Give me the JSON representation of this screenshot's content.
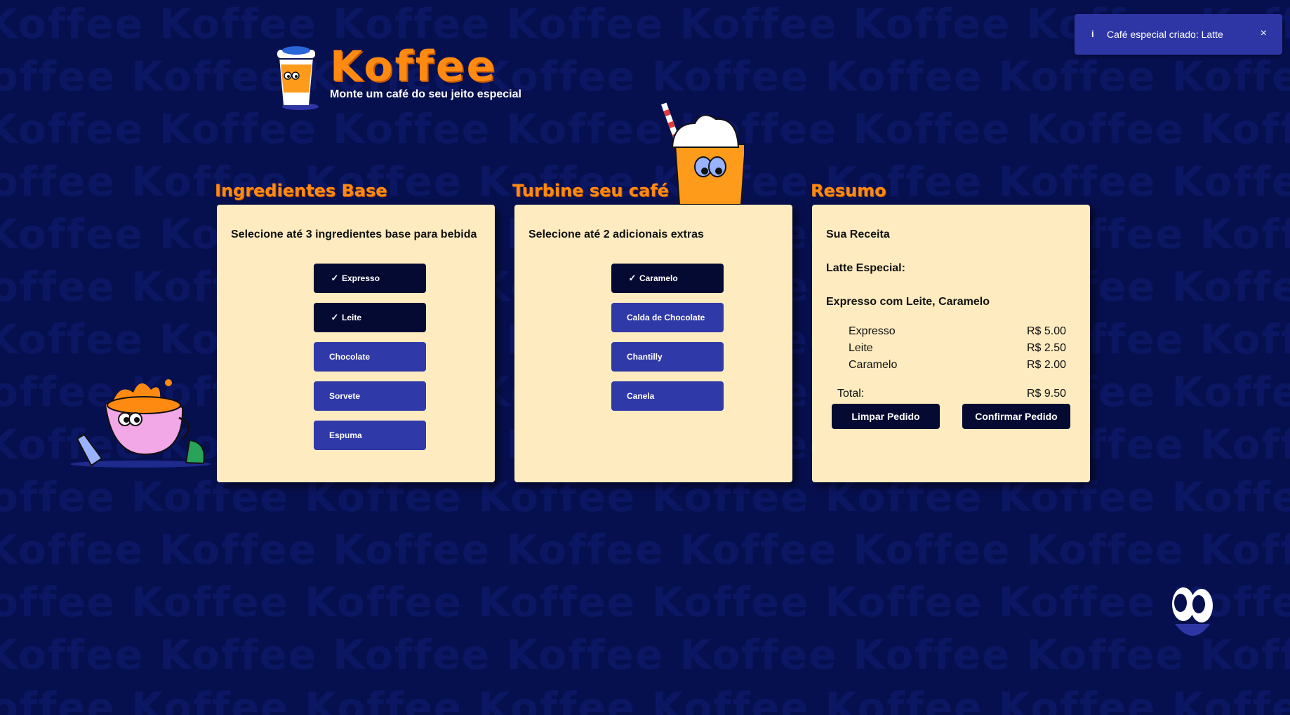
{
  "colors": {
    "background": "#07104f",
    "brand_orange": "#ff8a12",
    "card": "#feebbf",
    "button_blue": "#3039a8",
    "button_selected": "#050a33",
    "toast": "#2e36a6"
  },
  "background_watermark": "Koffee",
  "brand": {
    "logo_icon": "coffee-cup-mascot-icon",
    "title": "Koffee",
    "subtitle": "Monte um café do seu jeito especial"
  },
  "toast": {
    "icon": "info-icon",
    "icon_glyph": "i",
    "message": "Café especial criado: Latte",
    "close": "×"
  },
  "base": {
    "title": "Ingredientes Base",
    "instruction": "Selecione até 3 ingredientes base para bebida",
    "options": [
      {
        "label": "Expresso",
        "selected": true
      },
      {
        "label": "Leite",
        "selected": true
      },
      {
        "label": "Chocolate",
        "selected": false
      },
      {
        "label": "Sorvete",
        "selected": false
      },
      {
        "label": "Espuma",
        "selected": false
      }
    ]
  },
  "extras": {
    "title": "Turbine seu café",
    "instruction": "Selecione até 2 adicionais extras",
    "options": [
      {
        "label": "Caramelo",
        "selected": true
      },
      {
        "label": "Calda de Chocolate",
        "selected": false
      },
      {
        "label": "Chantilly",
        "selected": false
      },
      {
        "label": "Canela",
        "selected": false
      }
    ]
  },
  "check_glyph": "✓",
  "summary": {
    "title": "Resumo",
    "recipe_label": "Sua Receita",
    "drink_name": "Latte Especial:",
    "description": "Expresso com Leite, Caramelo",
    "items": [
      {
        "name": "Expresso",
        "price": "R$ 5.00"
      },
      {
        "name": "Leite",
        "price": "R$ 2.50"
      },
      {
        "name": "Caramelo",
        "price": "R$ 2.00"
      }
    ],
    "total_label": "Total:",
    "total_value": "R$ 9.50",
    "clear_label": "Limpar Pedido",
    "confirm_label": "Confirmar Pedido"
  },
  "decorations": {
    "left": "running-coffee-cup-mascot-icon",
    "center": "iced-coffee-mascot-icon",
    "bottom_right": "peeking-eyes-icon"
  }
}
